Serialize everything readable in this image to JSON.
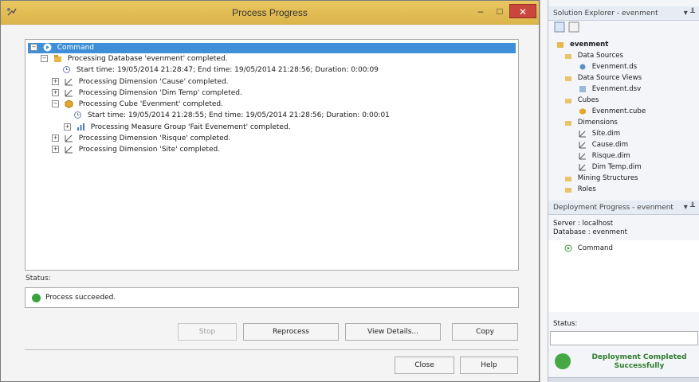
{
  "dialog": {
    "title": "Process Progress",
    "window_controls": {
      "minimize": "–",
      "maximize": "□",
      "close": "✕"
    },
    "tree": [
      {
        "text": "Command",
        "selected": true
      },
      {
        "text": "Processing Database 'evenment' completed."
      },
      {
        "text": "Start time: 19/05/2014 21:28:47; End time: 19/05/2014 21:28:56; Duration: 0:00:09"
      },
      {
        "text": "Processing Dimension 'Cause' completed."
      },
      {
        "text": "Processing Dimension 'Dim Temp' completed."
      },
      {
        "text": "Processing Cube 'Evenment' completed."
      },
      {
        "text": "Start time: 19/05/2014 21:28:55; End time: 19/05/2014 21:28:56; Duration: 0:00:01"
      },
      {
        "text": "Processing Measure Group 'Fait Evenement' completed."
      },
      {
        "text": "Processing Dimension 'Risque' completed."
      },
      {
        "text": "Processing Dimension 'Site' completed."
      }
    ],
    "status_label": "Status:",
    "status_message": "Process succeeded.",
    "buttons": {
      "stop": "Stop",
      "reprocess": "Reprocess",
      "view_details": "View Details...",
      "copy": "Copy",
      "close": "Close",
      "help": "Help"
    }
  },
  "solution_explorer": {
    "title": "Solution Explorer - evenment",
    "pin": "▾ ╨",
    "items": [
      "evenment",
      "Data Sources",
      "Evenment.ds",
      "Data Source Views",
      "Evenment.dsv",
      "Cubes",
      "Evenment.cube",
      "Dimensions",
      "Site.dim",
      "Cause.dim",
      "Risque.dim",
      "Dim Temp.dim",
      "Mining Structures",
      "Roles"
    ]
  },
  "deployment": {
    "title": "Deployment Progress - evenment",
    "pin": "▾ ╨",
    "server": "Server : localhost",
    "database": "Database : evenment",
    "command": "Command",
    "status_label": "Status:",
    "result_line1": "Deployment Completed",
    "result_line2": "Successfully"
  },
  "colors": {
    "title_bar": "#dcb54a",
    "selection": "#3f8fd8",
    "close_button": "#c8463b",
    "success_green": "#2f7d2f"
  }
}
